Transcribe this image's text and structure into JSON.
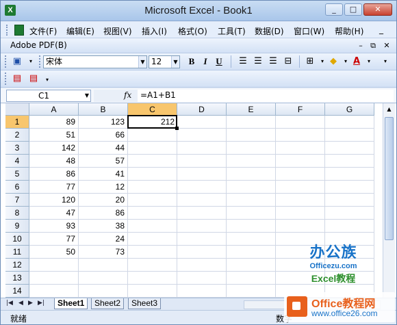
{
  "window": {
    "title": "Microsoft Excel - Book1",
    "minimize": "_",
    "maximize": "□",
    "close": "✕"
  },
  "menu": {
    "items": [
      "文件(F)",
      "编辑(E)",
      "视图(V)",
      "插入(I)",
      "格式(O)",
      "工具(T)",
      "数据(D)",
      "窗口(W)",
      "帮助(H)"
    ],
    "adobe": "Adobe PDF(B)"
  },
  "toolbar": {
    "font_name": "宋体",
    "font_size": "12",
    "bold": "B",
    "italic": "I",
    "underline": "U",
    "font_color_glyph": "A"
  },
  "formula_bar": {
    "name_box": "C1",
    "fx": "fx",
    "formula": "=A1+B1"
  },
  "grid": {
    "columns": [
      "A",
      "B",
      "C",
      "D",
      "E",
      "F",
      "G"
    ],
    "rows": [
      "1",
      "2",
      "3",
      "4",
      "5",
      "6",
      "7",
      "8",
      "9",
      "10",
      "11",
      "12",
      "13",
      "14"
    ],
    "col_a": [
      "89",
      "51",
      "142",
      "48",
      "86",
      "77",
      "120",
      "47",
      "93",
      "77",
      "50"
    ],
    "col_b": [
      "123",
      "66",
      "44",
      "57",
      "41",
      "12",
      "20",
      "86",
      "38",
      "24",
      "73"
    ],
    "c1": "212",
    "selected_cell": "C1"
  },
  "watermark": {
    "brand_cn": "办公族",
    "brand_url": "Officezu.com",
    "brand_tag": "Excel教程"
  },
  "sheets": {
    "tabs": [
      "Sheet1",
      "Sheet2",
      "Sheet3"
    ],
    "active": "Sheet1"
  },
  "status": {
    "ready": "就绪",
    "num": "数字"
  },
  "badge": {
    "title": "Office教程网",
    "url": "www.office26.com"
  }
}
